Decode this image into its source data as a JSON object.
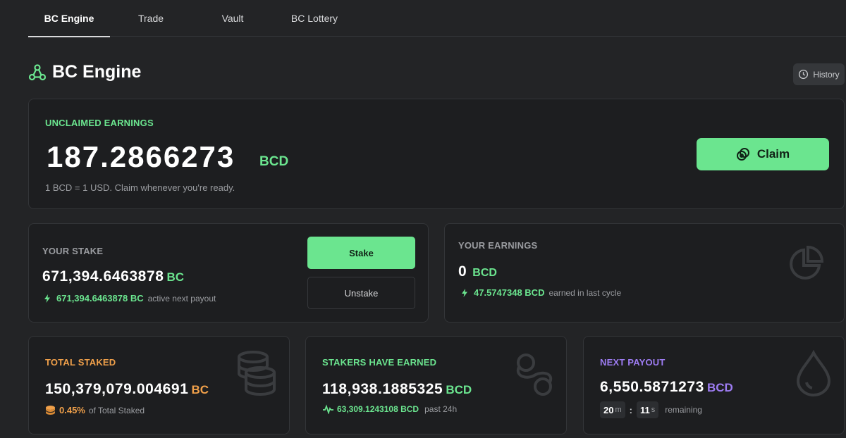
{
  "tabs": [
    {
      "label": "BC Engine",
      "active": true
    },
    {
      "label": "Trade",
      "active": false
    },
    {
      "label": "Vault",
      "active": false
    },
    {
      "label": "BC Lottery",
      "active": false
    }
  ],
  "page": {
    "title": "BC Engine",
    "history_label": "History"
  },
  "unclaimed": {
    "label": "UNCLAIMED EARNINGS",
    "amount": "187.2866273",
    "unit": "BCD",
    "note": "1 BCD = 1 USD. Claim whenever you're ready.",
    "claim_label": "Claim"
  },
  "stake": {
    "label": "YOUR STAKE",
    "amount": "671,394.6463878",
    "unit": "BC",
    "active_amount": "671,394.6463878 BC",
    "active_note": "active next payout",
    "stake_button": "Stake",
    "unstake_button": "Unstake"
  },
  "earnings": {
    "label": "YOUR EARNINGS",
    "amount": "0",
    "unit": "BCD",
    "cycle_amount": "47.5747348 BCD",
    "cycle_note": "earned in last cycle"
  },
  "total_staked": {
    "label": "TOTAL STAKED",
    "amount": "150,379,079.004691",
    "unit": "BC",
    "percent": "0.45%",
    "percent_note": "of Total Staked"
  },
  "stakers_earned": {
    "label": "STAKERS HAVE EARNED",
    "amount": "118,938.1885325",
    "unit": "BCD",
    "day_amount": "63,309.1243108 BCD",
    "day_note": "past 24h"
  },
  "next_payout": {
    "label": "NEXT PAYOUT",
    "amount": "6,550.5871273",
    "unit": "BCD",
    "minutes": "20",
    "minutes_unit": "m",
    "seconds": "11",
    "seconds_unit": "s",
    "remaining": "remaining"
  },
  "colors": {
    "accent_green": "#6be58f",
    "orange": "#f0a04a",
    "purple": "#9d7cf2",
    "background": "#232426",
    "card": "#1d1e20"
  },
  "icons": {
    "title": "engine-triangle-icon",
    "history": "clock-icon",
    "claim": "coins-icon",
    "bolt": "bolt-icon",
    "pie": "pie-chart-icon",
    "coin_stack": "coin-stack-icon",
    "pulse": "pulse-icon",
    "link": "link-icon",
    "drop": "drop-icon"
  }
}
